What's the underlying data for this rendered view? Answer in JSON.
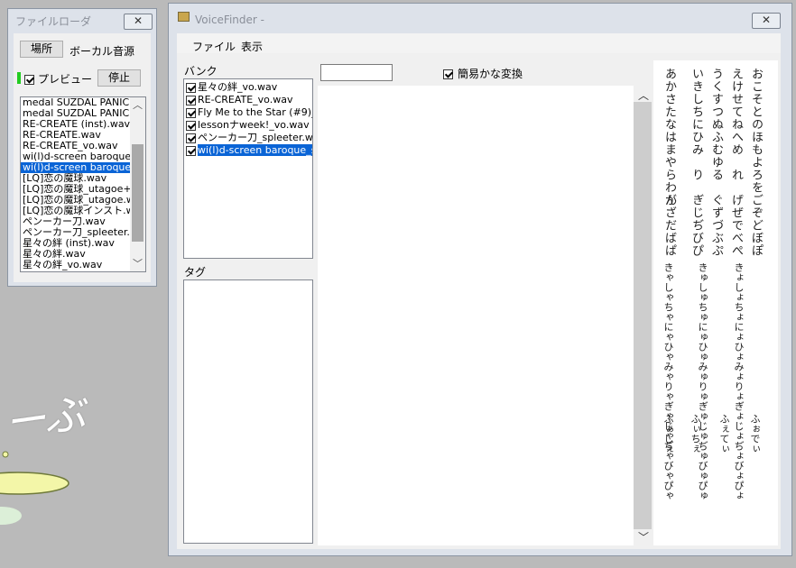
{
  "file_loader": {
    "title": "ファイルローダ",
    "close_glyph": "✕",
    "location_button": "場所",
    "source_label": "ボーカル音源",
    "preview_label": "プレビュー",
    "stop_button": "停止",
    "files": [
      "medal SUZDAL PANIC",
      "medal SUZDAL PANIC",
      "RE-CREATE (inst).wav",
      "RE-CREATE.wav",
      "RE-CREATE_vo.wav",
      "wi(l)d-screen baroque.w",
      "wi(l)d-screen baroque_s",
      "[LQ]恋の魔球.wav",
      "[LQ]恋の魔球_utagoe+s",
      "[LQ]恋の魔球_utagoe.wa",
      "[LQ]恋の魔球インスト.wa",
      "ペンーカー刀.wav",
      "ペンーカー刀_spleeter.wav",
      "星々の絆 (inst).wav",
      "星々の絆.wav",
      "星々の絆_vo.wav"
    ],
    "selected_index": 6
  },
  "voicefinder": {
    "title": "VoiceFinder -",
    "close_glyph": "✕",
    "menu": [
      "ファイル",
      "表示"
    ],
    "bank_label": "バンク",
    "bank_items": [
      "星々の絆_vo.wav",
      "RE-CREATE_vo.wav",
      "Fly Me to the Star (#9)_",
      "lessonナweek!_vo.wav",
      "ペンーカー刀_spleeter.wav",
      "wi(l)d-screen baroque_s"
    ],
    "bank_selected_index": 5,
    "tag_label": "タグ",
    "search_value": "",
    "kana_convert_label": "簡易かな変換",
    "scroll_up": "︿",
    "scroll_down": "﹀",
    "kana_table": {
      "basic": [
        "おこそとのほもよろを",
        "えけせてねへめ　れ",
        "うくすつぬふむゆる",
        "いきしちにひみ　り",
        "あかさたなはまやらわん"
      ],
      "dakuon": [
        "ごぞどぼぽ",
        "げぜでべぺ",
        "ぐずづぶぷ",
        "ぎじぢびぴ",
        "がざだばぱ"
      ],
      "youon": [
        "きょしょちょにょひょみょりょぎょじょぢょびょぴょ",
        "きゅしゅちゅにゅひゅみゅりゅぎゅじゅぢゅびゅぴゅ",
        "きゃしゃちゃにゃひゃみゃりゃぎゃじゃぢゃびゃぴゃ"
      ],
      "extra": [
        "ふぉでぃ",
        "ふぇてぃ",
        "ふぃちぇ",
        "ふぁしぇ"
      ]
    }
  },
  "background": {
    "art_text": "ーぶ"
  }
}
